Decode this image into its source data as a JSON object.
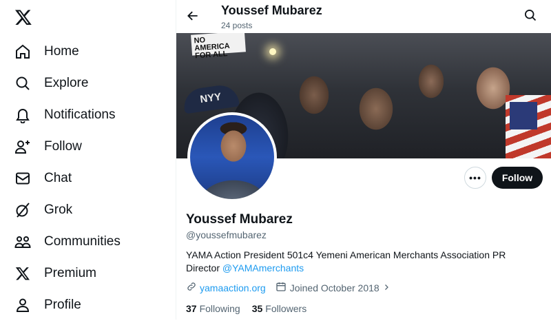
{
  "sidebar": {
    "logo_icon": "x-logo-icon",
    "items": [
      {
        "label": "Home",
        "icon": "home-icon"
      },
      {
        "label": "Explore",
        "icon": "search-icon"
      },
      {
        "label": "Notifications",
        "icon": "bell-icon"
      },
      {
        "label": "Follow",
        "icon": "person-plus-icon"
      },
      {
        "label": "Chat",
        "icon": "mail-icon"
      },
      {
        "label": "Grok",
        "icon": "grok-icon"
      },
      {
        "label": "Communities",
        "icon": "people-icon"
      },
      {
        "label": "Premium",
        "icon": "x-logo-icon"
      },
      {
        "label": "Profile",
        "icon": "person-icon"
      }
    ]
  },
  "header": {
    "name": "Youssef Mubarez",
    "posts": "24 posts"
  },
  "banner": {
    "sign_text": "NO\nAMERICA FOR ALL",
    "cap_text": "NYY"
  },
  "profile": {
    "name": "Youssef Mubarez",
    "handle": "@youssefmubarez",
    "bio": "YAMA Action President 501c4 Yemeni American Merchants Association PR Director ",
    "bio_mention": "@YAMAmerchants",
    "website": "yamaaction.org",
    "joined": "Joined October 2018",
    "following_count": "37",
    "following_label": "Following",
    "followers_count": "35",
    "followers_label": "Followers",
    "follow_button": "Follow",
    "more_button": "•••"
  },
  "colors": {
    "accent": "#1d9bf0",
    "text": "#0f1419",
    "muted": "#536471"
  }
}
